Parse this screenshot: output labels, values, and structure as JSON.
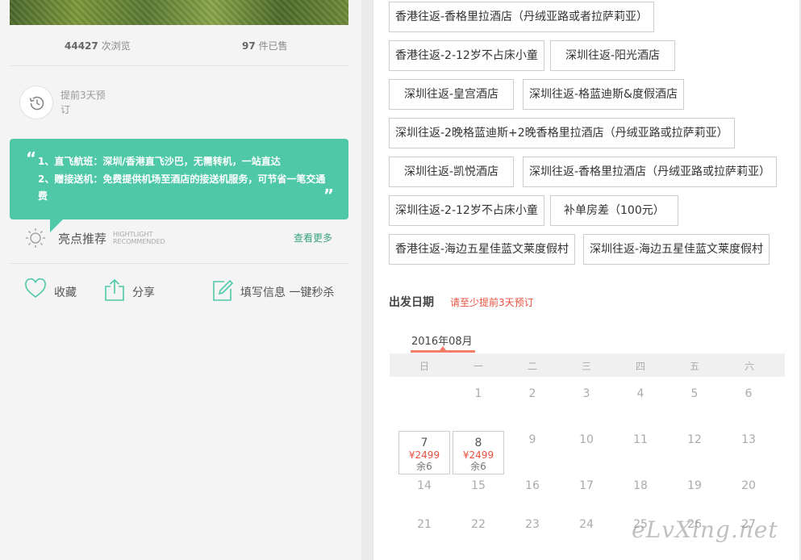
{
  "stats": {
    "views_count": "44427",
    "views_label": "次浏览",
    "sold_count": "97",
    "sold_label": "件已售"
  },
  "advance": {
    "text": "提前3天预订",
    "icon": "history-clock-icon"
  },
  "highlights_bubble": {
    "open_quote": "“",
    "close_quote": "”",
    "line1": "1、直飞航班：深圳/香港直飞沙巴，无需转机，一站直达",
    "line2": "2、赠接送机：免费提供机场至酒店的接送机服务，可节省一笔交通费"
  },
  "highlight_header": {
    "title": "亮点推荐",
    "sub_en_1": "HIGHTLIGHT",
    "sub_en_2": "RECOMMENDED",
    "more_link": "查看更多"
  },
  "actions": {
    "favorite": "收藏",
    "share": "分享",
    "fill_info": "填写信息 一键秒杀"
  },
  "options": [
    "香港往返-香格里拉酒店（丹绒亚路或者拉萨莉亚）",
    "香港往返-2-12岁不占床小童",
    "深圳往返-阳光酒店",
    "深圳往返-皇宫酒店",
    "深圳往返-格蓝迪斯&度假酒店",
    "深圳往返-2晚格蓝迪斯+2晚香格里拉酒店（丹绒亚路或拉萨莉亚）",
    "深圳往返-凯悦酒店",
    "深圳往返-香格里拉酒店（丹绒亚路或拉萨莉亚）",
    "深圳往返-2-12岁不占床小童",
    "补单房差（100元）",
    "香港往返-海边五星佳蓝文莱度假村",
    "深圳往返-海边五星佳蓝文莱度假村"
  ],
  "departure": {
    "title": "出发日期",
    "note": "请至少提前3天预订",
    "month": "2016年08月"
  },
  "calendar": {
    "weekdays": [
      "日",
      "一",
      "二",
      "三",
      "四",
      "五",
      "六"
    ],
    "week1": [
      "1",
      "2",
      "3",
      "4",
      "5",
      "6"
    ],
    "available": [
      {
        "day": "7",
        "price": "¥2499",
        "remain": "余6"
      },
      {
        "day": "8",
        "price": "¥2499",
        "remain": "余6"
      }
    ],
    "week2_rest": [
      "9",
      "10",
      "11",
      "12",
      "13"
    ],
    "week3": [
      "14",
      "15",
      "16",
      "17",
      "18",
      "19",
      "20"
    ],
    "week4": [
      "21",
      "22",
      "23",
      "24",
      "25",
      "26",
      "27"
    ]
  },
  "watermark": "eLvXing.net",
  "colors": {
    "accent_green": "#4ec8a7",
    "link_green": "#3aa37e",
    "note_red": "#e8513f",
    "month_bar": "#f07e68"
  }
}
